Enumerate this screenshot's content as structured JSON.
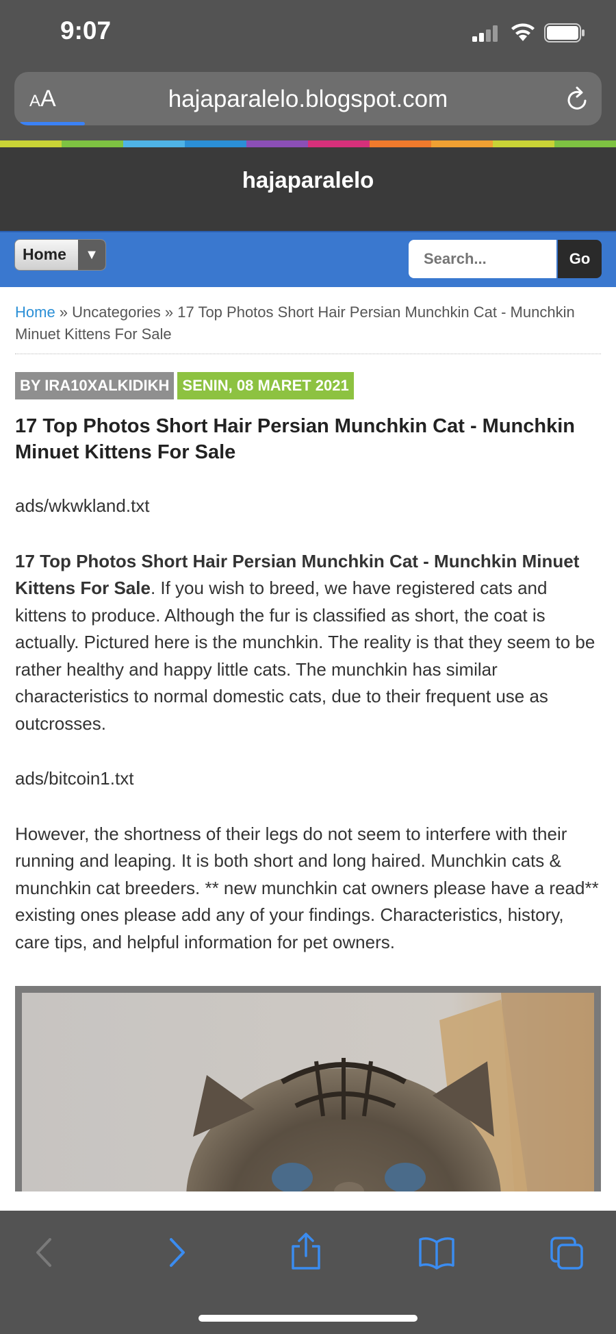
{
  "status": {
    "time": "9:07"
  },
  "browser": {
    "aa_label": "AA",
    "url": "hajaparalelo.blogspot.com"
  },
  "blog": {
    "title": "hajaparalelo",
    "nav_home": "Home",
    "search_placeholder": "Search...",
    "go_label": "Go"
  },
  "breadcrumb": {
    "home": "Home",
    "sep1": " » ",
    "category": "Uncategories",
    "sep2": " » ",
    "current": "17 Top Photos Short Hair Persian Munchkin Cat - Munchkin Minuet Kittens For Sale"
  },
  "post": {
    "author": "BY IRA10XALKIDIKH",
    "date": "SENIN, 08 MARET 2021",
    "title": "17 Top Photos Short Hair Persian Munchkin Cat - Munchkin Minuet Kittens For Sale",
    "ads1": "ads/wkwkland.txt",
    "p1_bold": "17 Top Photos Short Hair Persian Munchkin Cat - Munchkin Minuet Kittens For Sale",
    "p1_text": ". If you wish to breed, we have registered cats and kittens to produce. Although the fur is classified as short, the coat is actually. Pictured here is the munchkin. The reality is that they seem to be rather healthy and happy little cats. The munchkin has similar characteristics to normal domestic cats, due to their frequent use as outcrosses.",
    "ads2": "ads/bitcoin1.txt",
    "p2_text": "However, the shortness of their legs do not seem to interfere with their running and leaping. It is both short and long haired. Munchkin cats & munchkin cat breeders. ** new munchkin cat owners please have a read** existing ones please add any of your findings. Characteristics, history, care tips, and helpful information for pet owners."
  },
  "colors": {
    "nav_blue": "#3a78cf",
    "header_dark": "#3a3a3a",
    "date_green": "#8dc241",
    "author_gray": "#8f8f8f",
    "link_blue": "#2b8fd6",
    "ios_blue": "#3b82f6"
  },
  "icons": {
    "status": [
      "signal-icon",
      "wifi-icon",
      "battery-icon"
    ],
    "toolbar": [
      "back-icon",
      "forward-icon",
      "share-icon",
      "bookmarks-icon",
      "tabs-icon"
    ]
  }
}
